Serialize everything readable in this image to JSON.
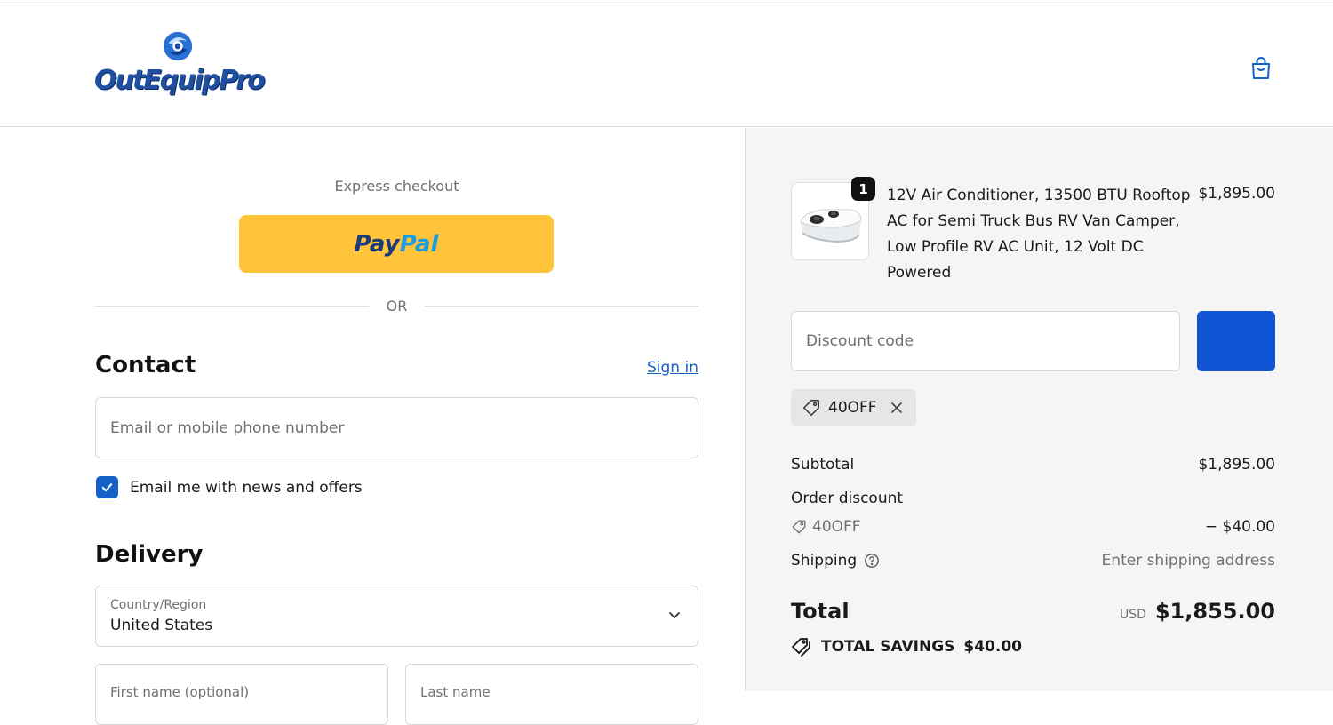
{
  "header": {
    "logo_text": "OutEquipPro"
  },
  "express": {
    "label": "Express checkout",
    "paypal_pay": "Pay",
    "paypal_pal": "Pal"
  },
  "divider": {
    "or_text": "OR"
  },
  "contact": {
    "title": "Contact",
    "signin_label": "Sign in",
    "email_placeholder": "Email or mobile phone number",
    "email_value": "",
    "news_checked": true,
    "news_label": "Email me with news and offers"
  },
  "delivery": {
    "title": "Delivery",
    "country_label": "Country/Region",
    "country_value": "United States",
    "first_name_placeholder": "First name (optional)",
    "last_name_placeholder": "Last name"
  },
  "order": {
    "item": {
      "quantity": "1",
      "name": "12V Air Conditioner, 13500 BTU Rooftop AC for Semi Truck Bus RV Van Camper, Low Profile RV AC Unit, 12 Volt DC Powered",
      "price": "$1,895.00"
    },
    "discount_placeholder": "Discount code",
    "applied_code": "40OFF",
    "subtotal_label": "Subtotal",
    "subtotal_value": "$1,895.00",
    "order_discount_label": "Order discount",
    "discount_code_label": "40OFF",
    "discount_value": "− $40.00",
    "shipping_label": "Shipping",
    "shipping_value": "Enter shipping address",
    "total_label": "Total",
    "currency": "USD",
    "total_value": "$1,855.00",
    "savings_label": "TOTAL SAVINGS",
    "savings_value": "$40.00"
  },
  "colors": {
    "accent": "#1561c7",
    "apply_button": "#1155d4",
    "paypal_yellow": "#ffc439",
    "summary_bg": "#f5f5f5"
  }
}
